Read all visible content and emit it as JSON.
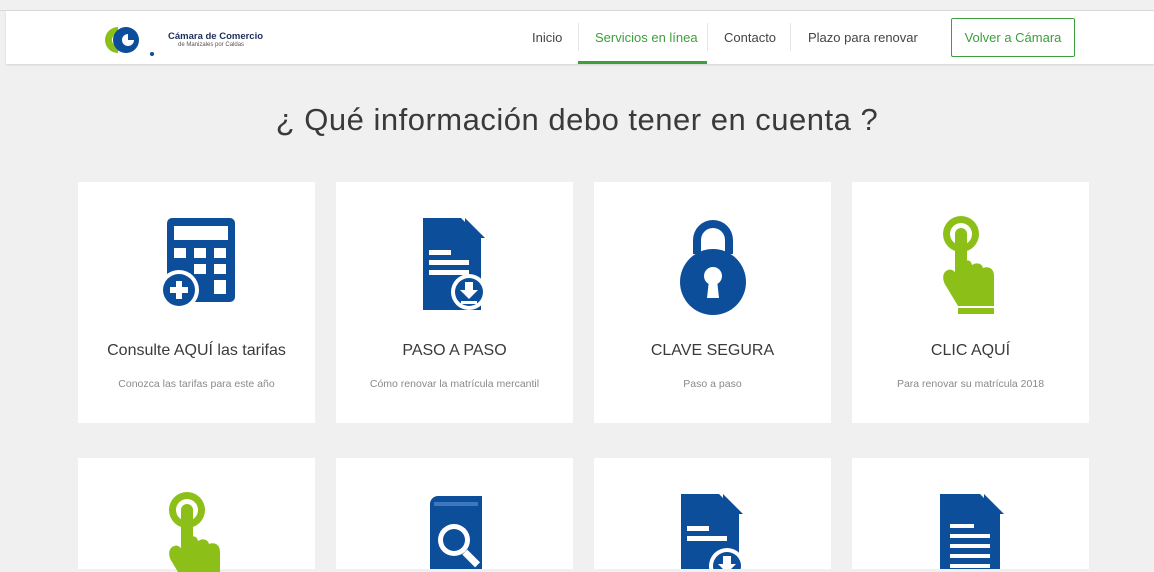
{
  "brand": {
    "name": "Cámara de Comercio",
    "subtitle": "de Manizales por Caldas",
    "colors": {
      "blue": "#0d4e9a",
      "green": "#8cc018",
      "accent": "#3c9e3c"
    }
  },
  "nav": {
    "items": [
      {
        "label": "Inicio",
        "active": false
      },
      {
        "label": "Servicios en línea",
        "active": true
      },
      {
        "label": "Contacto",
        "active": false
      },
      {
        "label": "Plazo para renovar",
        "active": false
      }
    ],
    "cta_label": "Volver a Cámara"
  },
  "main": {
    "title": "¿ Qué información debo tener en cuenta ?",
    "cards": [
      {
        "title": "Consulte AQUÍ las tarifas",
        "desc": "Conozca las tarifas para este año",
        "icon": "calculator-plus-icon"
      },
      {
        "title": "PASO A PASO",
        "desc": "Cómo renovar la matrícula mercantil",
        "icon": "document-download-icon"
      },
      {
        "title": "CLAVE SEGURA",
        "desc": "Paso a paso",
        "icon": "padlock-icon"
      },
      {
        "title": "CLIC AQUÍ",
        "desc": "Para renovar su matrícula 2018",
        "icon": "click-hand-icon"
      }
    ],
    "second_row_icons": [
      "click-hand-icon",
      "book-search-icon",
      "document-download-icon",
      "document-lines-icon"
    ]
  }
}
